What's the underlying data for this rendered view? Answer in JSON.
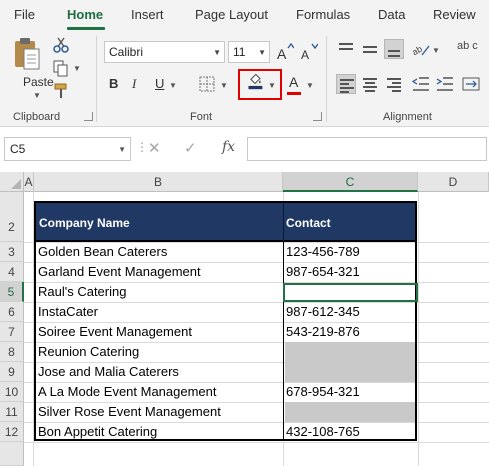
{
  "tabs": [
    "File",
    "Home",
    "Insert",
    "Page Layout",
    "Formulas",
    "Data",
    "Review"
  ],
  "active_tab": "Home",
  "ribbon": {
    "clipboard": {
      "label": "Clipboard",
      "paste_label": "Paste"
    },
    "font": {
      "label": "Font",
      "font_name": "Calibri",
      "font_size": "11",
      "bold": "B",
      "italic": "I",
      "underline": "U",
      "font_color_glyph": "A"
    },
    "alignment": {
      "label": "Alignment"
    },
    "wrap_abbrev": "ab c"
  },
  "formula_bar": {
    "name_box": "C5",
    "fx": "fx",
    "formula": ""
  },
  "columns": [
    "A",
    "B",
    "C",
    "D"
  ],
  "rows": [
    "2",
    "3",
    "4",
    "5",
    "6",
    "7",
    "8",
    "9",
    "10",
    "11",
    "12"
  ],
  "selected_cell": "C5",
  "table": {
    "headers": [
      "Company Name",
      "Contact"
    ],
    "rows": [
      {
        "company": "Golden Bean Caterers",
        "contact": "123-456-789",
        "gray": false
      },
      {
        "company": "Garland Event Management",
        "contact": "987-654-321",
        "gray": false
      },
      {
        "company": "Raul's Catering",
        "contact": "",
        "gray": false
      },
      {
        "company": "InstaCater",
        "contact": "987-612-345",
        "gray": false
      },
      {
        "company": "Soiree Event Management",
        "contact": "543-219-876",
        "gray": false
      },
      {
        "company": "Reunion Catering",
        "contact": "",
        "gray": true
      },
      {
        "company": "Jose and Malia Caterers",
        "contact": "",
        "gray": true
      },
      {
        "company": "A La Mode Event Management",
        "contact": "678-954-321",
        "gray": false
      },
      {
        "company": "Silver Rose Event Management",
        "contact": "",
        "gray": true
      },
      {
        "company": "Bon Appetit Catering",
        "contact": "432-108-765",
        "gray": false
      }
    ]
  },
  "colors": {
    "header_fill": "#1f3864",
    "gray_fill": "#c9c9c9",
    "accent": "#217346",
    "highlight": "#e00000"
  }
}
